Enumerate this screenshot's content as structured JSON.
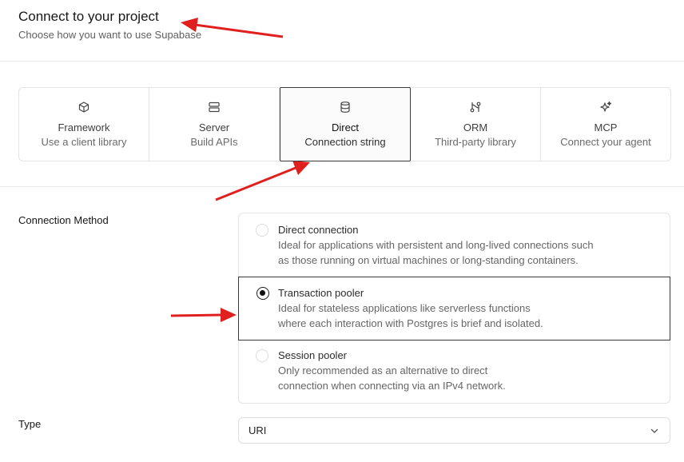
{
  "header": {
    "title": "Connect to your project",
    "subtitle": "Choose how you want to use Supabase"
  },
  "tabs": [
    {
      "label": "Framework",
      "desc": "Use a client library",
      "icon": "cube-icon",
      "active": false
    },
    {
      "label": "Server",
      "desc": "Build APIs",
      "icon": "server-icon",
      "active": false
    },
    {
      "label": "Direct",
      "desc": "Connection string",
      "icon": "database-icon",
      "active": true
    },
    {
      "label": "ORM",
      "desc": "Third-party library",
      "icon": "orm-icon",
      "active": false
    },
    {
      "label": "MCP",
      "desc": "Connect your agent",
      "icon": "sparkles-icon",
      "active": false
    }
  ],
  "connection_method": {
    "label": "Connection Method",
    "options": [
      {
        "title": "Direct connection",
        "desc_line1": "Ideal for applications with persistent and long-lived connections such",
        "desc_line2": "as those running on virtual machines or long-standing containers.",
        "selected": false
      },
      {
        "title": "Transaction pooler",
        "desc_line1": "Ideal for stateless applications like serverless functions",
        "desc_line2": "where each interaction with Postgres is brief and isolated.",
        "selected": true
      },
      {
        "title": "Session pooler",
        "desc_line1": "Only recommended as an alternative to direct",
        "desc_line2": "connection when connecting via an IPv4 network.",
        "selected": false
      }
    ]
  },
  "type": {
    "label": "Type",
    "value": "URI"
  },
  "colors": {
    "annotation_arrow": "#e0201f",
    "active_border": "#3a3a3a"
  }
}
